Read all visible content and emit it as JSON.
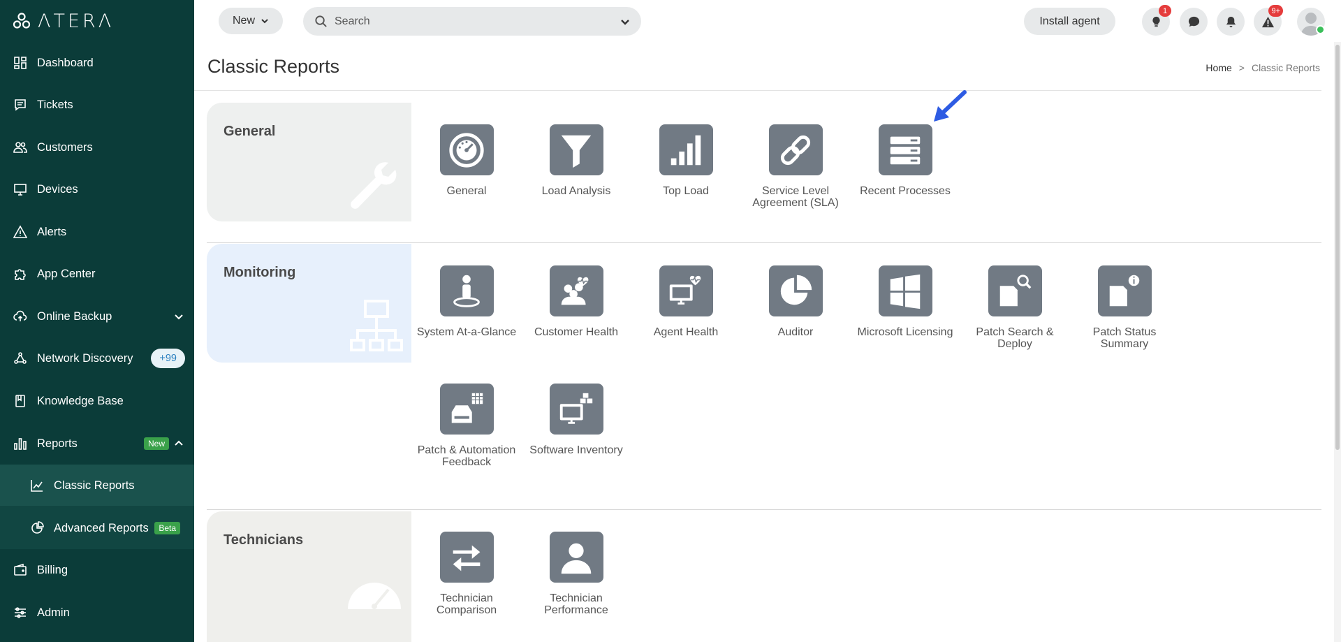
{
  "app": {
    "logo": "ΛTERΛ"
  },
  "sidebar": {
    "items": [
      {
        "label": "Dashboard"
      },
      {
        "label": "Tickets"
      },
      {
        "label": "Customers"
      },
      {
        "label": "Devices"
      },
      {
        "label": "Alerts"
      },
      {
        "label": "App Center"
      },
      {
        "label": "Online Backup"
      },
      {
        "label": "Network Discovery",
        "badge": "+99"
      },
      {
        "label": "Knowledge Base"
      },
      {
        "label": "Reports",
        "badge": "New"
      },
      {
        "label": "Classic Reports"
      },
      {
        "label": "Advanced Reports",
        "badge": "Beta"
      },
      {
        "label": "Billing"
      },
      {
        "label": "Admin"
      }
    ]
  },
  "topbar": {
    "new_label": "New",
    "search_placeholder": "Search",
    "install_label": "Install agent",
    "tips_badge": "1",
    "alerts_badge": "9+"
  },
  "page": {
    "title": "Classic Reports",
    "breadcrumb": {
      "home": "Home",
      "separator": ">",
      "current": "Classic Reports"
    }
  },
  "sections": [
    {
      "title": "General",
      "bg": "#eef0ef",
      "reports": [
        "General",
        "Load Analysis",
        "Top Load",
        "Service Level Agreement (SLA)",
        "Recent Processes"
      ]
    },
    {
      "title": "Monitoring",
      "bg": "#e7f0fc",
      "reports": [
        "System At-a-Glance",
        "Customer Health",
        "Agent Health",
        "Auditor",
        "Microsoft Licensing",
        "Patch Search & Deploy",
        "Patch Status Summary",
        "Patch & Automation Feedback",
        "Software Inventory"
      ]
    },
    {
      "title": "Technicians",
      "bg": "#efefec",
      "reports": [
        "Technician Comparison",
        "Technician Performance"
      ]
    }
  ],
  "colors": {
    "sidebar_bg": "#0b3c39",
    "tile_bg": "#717a84",
    "accent_arrow": "#2d5be3",
    "badge_red": "#e53c3c",
    "badge_green": "#3aa14a"
  }
}
